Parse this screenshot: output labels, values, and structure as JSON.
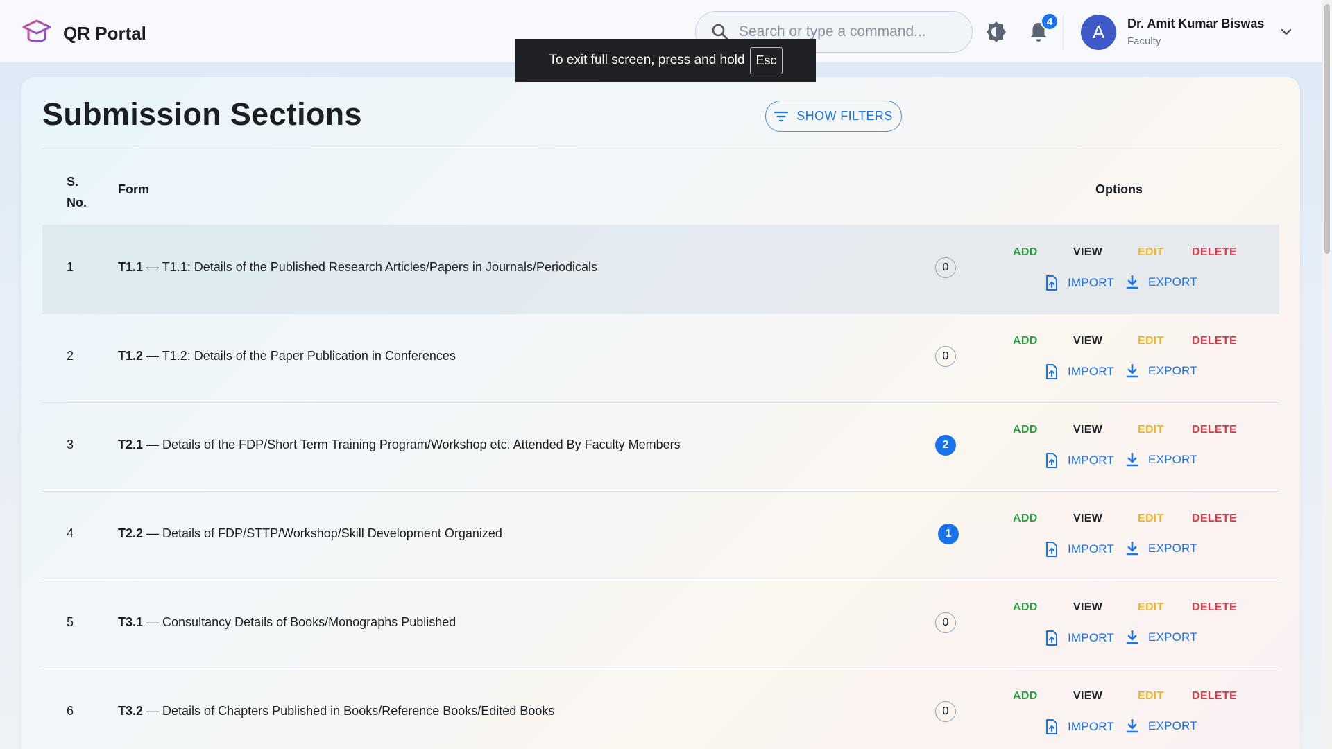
{
  "app": {
    "name": "QR Portal"
  },
  "search": {
    "placeholder": "Search or type a command..."
  },
  "notifications": {
    "count": "4"
  },
  "user": {
    "initial": "A",
    "name": "Dr. Amit Kumar Biswas",
    "role": "Faculty"
  },
  "fullscreen_toast": {
    "text": "To exit full screen, press and hold",
    "key": "Esc"
  },
  "page": {
    "title": "Submission Sections",
    "filter_button": "SHOW FILTERS"
  },
  "table": {
    "headers": {
      "sno_line1": "S.",
      "sno_line2": "No.",
      "form": "Form",
      "options": "Options"
    },
    "actions": {
      "add": "ADD",
      "view": "VIEW",
      "edit": "EDIT",
      "delete": "DELETE",
      "import": "IMPORT",
      "export": "EXPORT"
    },
    "rows": [
      {
        "sno": "1",
        "code": "T1.1",
        "title": " — T1.1: Details of the Published Research Articles/Papers in Journals/Periodicals",
        "count": "0"
      },
      {
        "sno": "2",
        "code": "T1.2",
        "title": " — T1.2: Details of the Paper Publication in Conferences",
        "count": "0"
      },
      {
        "sno": "3",
        "code": "T2.1",
        "title": " — Details of the FDP/Short Term Training Program/Workshop etc. Attended By Faculty Members",
        "count": "2"
      },
      {
        "sno": "4",
        "code": "T2.2",
        "title": " — Details of FDP/STTP/Workshop/Skill Development Organized",
        "count": "1"
      },
      {
        "sno": "5",
        "code": "T3.1",
        "title": " — Consultancy Details of Books/Monographs Published",
        "count": "0"
      },
      {
        "sno": "6",
        "code": "T3.2",
        "title": " — Details of Chapters Published in Books/Reference Books/Edited Books",
        "count": "0"
      }
    ]
  },
  "colors": {
    "accent": "#1a73e8",
    "add": "#2e9e44",
    "edit": "#f2b623",
    "delete": "#e03a4a",
    "avatar": "#3f5ac8"
  }
}
